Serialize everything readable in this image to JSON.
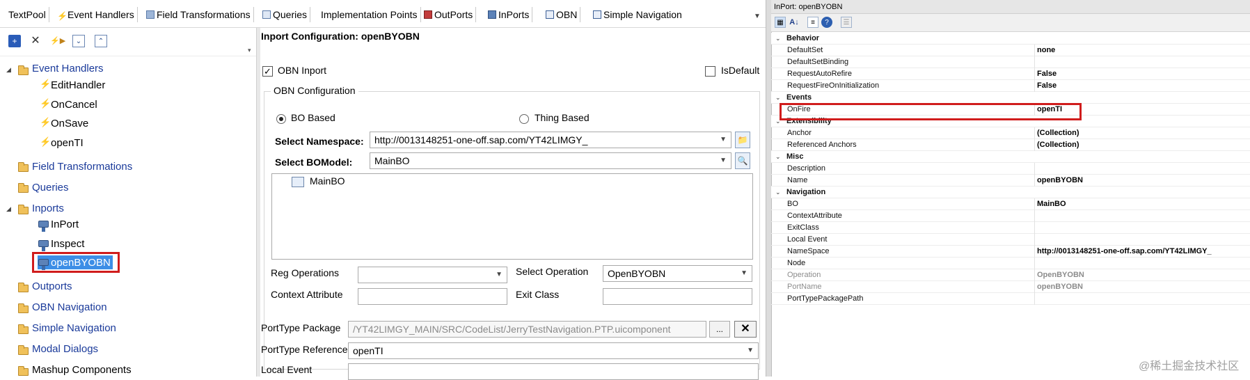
{
  "tabs": [
    {
      "label": "TextPool",
      "icon": "none"
    },
    {
      "label": "Event Handlers",
      "icon": "bolt-icon"
    },
    {
      "label": "Field Transformations",
      "icon": "transform-icon"
    },
    {
      "label": "Queries",
      "icon": "query-icon"
    },
    {
      "label": "Implementation Points",
      "icon": "none"
    },
    {
      "label": "OutPorts",
      "icon": "outport-icon"
    },
    {
      "label": "InPorts",
      "icon": "inport-icon"
    },
    {
      "label": "OBN",
      "icon": "obn-icon"
    },
    {
      "label": "Simple Navigation",
      "icon": "navigation-icon"
    }
  ],
  "tree": {
    "event_handlers": "Event Handlers",
    "edit_handler": "EditHandler",
    "on_cancel": "OnCancel",
    "on_save": "OnSave",
    "open_ti": "openTI",
    "field_transformations": "Field Transformations",
    "queries": "Queries",
    "inports": "Inports",
    "inport": "InPort",
    "inspect": "Inspect",
    "open_byobn": "openBYOBN",
    "outports": "Outports",
    "obn_navigation": "OBN Navigation",
    "simple_navigation": "Simple Navigation",
    "modal_dialogs": "Modal Dialogs",
    "mashup_components": "Mashup Components"
  },
  "config": {
    "title": "Inport Configuration: openBYOBN",
    "obn_inport_label": "OBN Inport",
    "obn_inport_checked": true,
    "is_default_label": "IsDefault",
    "is_default_checked": false,
    "obn_group_title": "OBN Configuration",
    "bo_based_label": "BO Based",
    "thing_based_label": "Thing Based",
    "selected_mode": "BO Based",
    "namespace_label": "Select Namespace:",
    "namespace_value": "http://0013148251-one-off.sap.com/YT42LIMGY_",
    "bomodel_label": "Select BOModel:",
    "bomodel_value": "MainBO",
    "bo_list_item": "MainBO",
    "reg_operations_label": "Reg Operations",
    "reg_operations_value": "",
    "select_operation_label": "Select Operation",
    "select_operation_value": "OpenBYOBN",
    "context_attribute_label": "Context Attribute",
    "context_attribute_value": "",
    "exit_class_label": "Exit Class",
    "exit_class_value": "",
    "porttype_package_label": "PortType Package",
    "porttype_package_value": "/YT42LIMGY_MAIN/SRC/CodeList/JerryTestNavigation.PTP.uicomponent",
    "browse_label": "...",
    "porttype_reference_label": "PortType Reference",
    "porttype_reference_value": "openTI",
    "local_event_label": "Local Event",
    "local_event_value": ""
  },
  "properties": {
    "title": "InPort: openBYOBN",
    "rows": [
      {
        "kind": "cat",
        "name": "Behavior",
        "value": ""
      },
      {
        "kind": "prop",
        "name": "DefaultSet",
        "value": "none"
      },
      {
        "kind": "prop",
        "name": "DefaultSetBinding",
        "value": ""
      },
      {
        "kind": "prop",
        "name": "RequestAutoRefire",
        "value": "False"
      },
      {
        "kind": "prop",
        "name": "RequestFireOnInitialization",
        "value": "False"
      },
      {
        "kind": "cat",
        "name": "Events",
        "value": ""
      },
      {
        "kind": "prop",
        "name": "OnFire",
        "value": "openTI"
      },
      {
        "kind": "cat",
        "name": "Extensibility",
        "value": ""
      },
      {
        "kind": "prop",
        "name": "Anchor",
        "value": "(Collection)"
      },
      {
        "kind": "prop",
        "name": "Referenced Anchors",
        "value": "(Collection)"
      },
      {
        "kind": "cat",
        "name": "Misc",
        "value": ""
      },
      {
        "kind": "prop",
        "name": "Description",
        "value": ""
      },
      {
        "kind": "prop",
        "name": "Name",
        "value": "openBYOBN"
      },
      {
        "kind": "cat",
        "name": "Navigation",
        "value": ""
      },
      {
        "kind": "prop",
        "name": "BO",
        "value": "MainBO"
      },
      {
        "kind": "prop",
        "name": "ContextAttribute",
        "value": ""
      },
      {
        "kind": "prop",
        "name": "ExitClass",
        "value": ""
      },
      {
        "kind": "prop",
        "name": "Local Event",
        "value": ""
      },
      {
        "kind": "prop",
        "name": "NameSpace",
        "value": "http://0013148251-one-off.sap.com/YT42LIMGY_"
      },
      {
        "kind": "prop",
        "name": "Node",
        "value": ""
      },
      {
        "kind": "gray",
        "name": "Operation",
        "value": "OpenBYOBN"
      },
      {
        "kind": "gray",
        "name": "PortName",
        "value": "openBYOBN"
      },
      {
        "kind": "prop",
        "name": "PortTypePackagePath",
        "value": ""
      }
    ]
  },
  "watermark": "@稀土掘金技术社区",
  "colors": {
    "highlight_outline": "#d01c1c",
    "selection": "#3d8ee6",
    "folder": "#f0c15a",
    "link_text": "#1a3a9a"
  }
}
